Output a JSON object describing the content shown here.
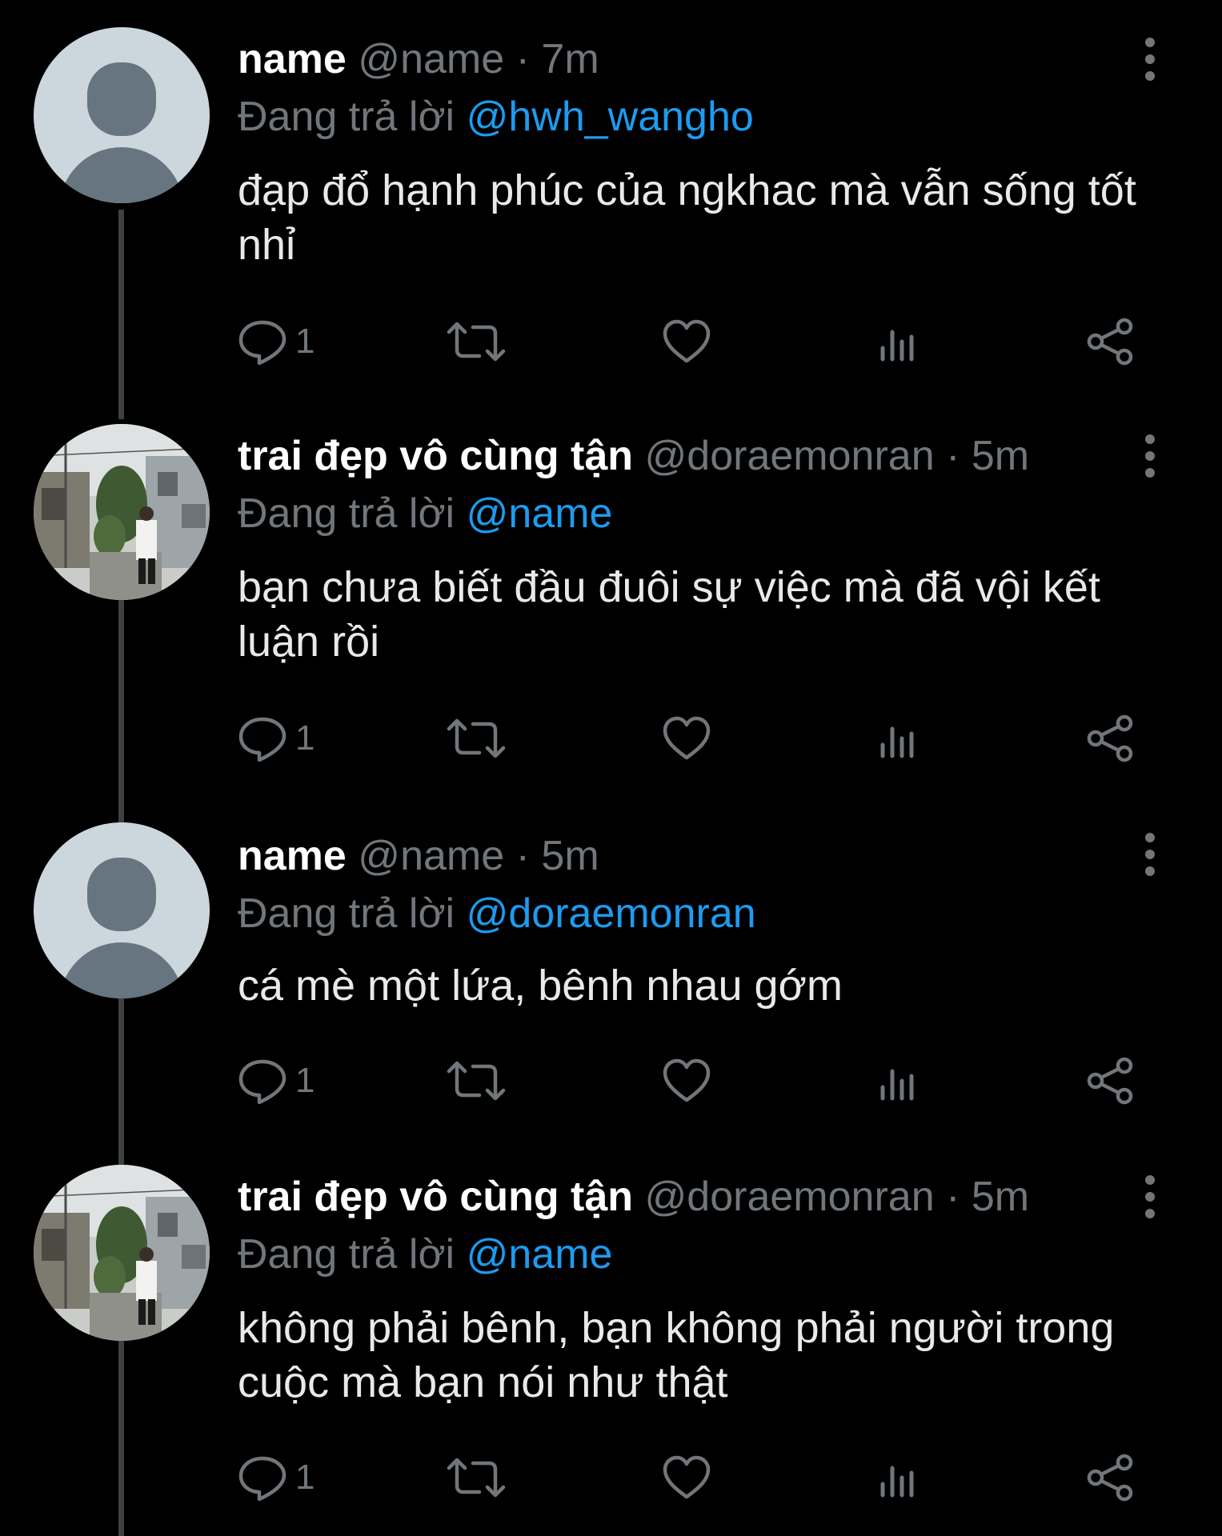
{
  "colors": {
    "background": "#000000",
    "text": "#e7e9ea",
    "muted": "#71767b",
    "mention": "#1d9bf0",
    "thread_line": "#3e4144"
  },
  "tweets": [
    {
      "display_name": "name",
      "handle": "@name",
      "separator": "·",
      "time": "7m",
      "reply_prefix": "Đang trả lời",
      "reply_to": "@hwh_wangho",
      "body": "đạp đổ hạnh phúc của ngkhac mà vẫn sống tốt nhỉ",
      "reply_count": "1",
      "avatar": "default-avatar"
    },
    {
      "display_name": "trai đẹp vô cùng tận",
      "handle": "@doraemonran",
      "separator": "·",
      "time": "5m",
      "reply_prefix": "Đang trả lời",
      "reply_to": "@name",
      "body": "bạn chưa biết đầu đuôi sự việc mà đã vội kết luận rồi",
      "reply_count": "1",
      "avatar": "photo-avatar"
    },
    {
      "display_name": "name",
      "handle": "@name",
      "separator": "·",
      "time": "5m",
      "reply_prefix": "Đang trả lời",
      "reply_to": "@doraemonran",
      "body": "cá mè một lứa, bênh nhau gớm",
      "reply_count": "1",
      "avatar": "default-avatar"
    },
    {
      "display_name": "trai đẹp vô cùng tận",
      "handle": "@doraemonran",
      "separator": "·",
      "time": "5m",
      "reply_prefix": "Đang trả lời",
      "reply_to": "@name",
      "body": "không phải bênh, bạn không phải người trong cuộc mà bạn nói như thật",
      "reply_count": "1",
      "avatar": "photo-avatar"
    }
  ],
  "icons": {
    "reply": "reply-icon",
    "retweet": "retweet-icon",
    "like": "heart-icon",
    "views": "views-icon",
    "share": "share-icon",
    "more": "more-vertical-icon"
  }
}
